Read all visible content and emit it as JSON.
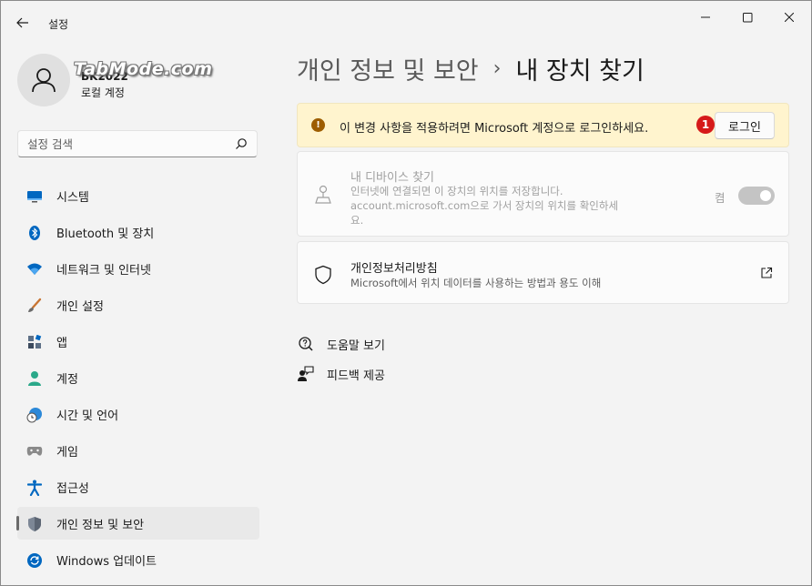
{
  "window": {
    "title": "설정"
  },
  "profile": {
    "name": "BK2022",
    "account_type": "로컬 계정",
    "watermark": "TabMode.com"
  },
  "search": {
    "placeholder": "설정 검색"
  },
  "sidebar": {
    "items": [
      {
        "label": "시스템",
        "icon": "monitor-icon"
      },
      {
        "label": "Bluetooth 및 장치",
        "icon": "bluetooth-icon"
      },
      {
        "label": "네트워크 및 인터넷",
        "icon": "wifi-icon"
      },
      {
        "label": "개인 설정",
        "icon": "brush-icon"
      },
      {
        "label": "앱",
        "icon": "apps-icon"
      },
      {
        "label": "계정",
        "icon": "person-icon"
      },
      {
        "label": "시간 및 언어",
        "icon": "globe-clock-icon"
      },
      {
        "label": "게임",
        "icon": "gamepad-icon"
      },
      {
        "label": "접근성",
        "icon": "accessibility-icon"
      },
      {
        "label": "개인 정보 및 보안",
        "icon": "shield-icon",
        "active": true
      },
      {
        "label": "Windows 업데이트",
        "icon": "update-icon"
      }
    ]
  },
  "header": {
    "parent": "개인 정보 및 보안",
    "separator": "›",
    "current": "내 장치 찾기"
  },
  "warning": {
    "text": "이 변경 사항을 적용하려면 Microsoft 계정으로 로그인하세요.",
    "marker": "1",
    "button": "로그인"
  },
  "find_device": {
    "title": "내 디바이스 찾기",
    "description": "인터넷에 연결되면 이 장치의 위치를 저장합니다. account.microsoft.com으로 가서 장치의 위치를 확인하세요.",
    "toggle_label": "켬",
    "toggle_on": true,
    "disabled": true
  },
  "privacy_statement": {
    "title": "개인정보처리방침",
    "description": "Microsoft에서 위치 데이터를 사용하는 방법과 용도 이해"
  },
  "links": {
    "help": "도움말 보기",
    "feedback": "피드백 제공"
  },
  "colors": {
    "accent": "#0067c0",
    "warning_bg": "#fff4ce",
    "warning_icon": "#9d5d00",
    "marker": "#d61a1a"
  }
}
